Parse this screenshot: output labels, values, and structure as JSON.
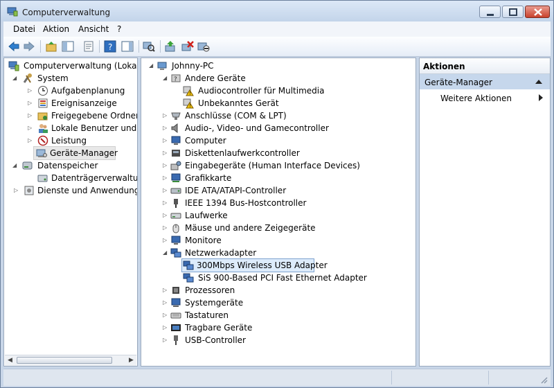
{
  "window": {
    "title": "Computerverwaltung"
  },
  "menu": [
    "Datei",
    "Aktion",
    "Ansicht",
    "?"
  ],
  "toolbar": {
    "icons": [
      "back-arrow-icon",
      "forward-arrow-icon",
      "up-folder-icon",
      "show-hide-tree-icon",
      "properties-icon",
      "help-icon",
      "show-action-pane-icon",
      "scan-hardware-icon",
      "update-driver-icon",
      "uninstall-device-icon",
      "disable-device-icon"
    ]
  },
  "left_tree": [
    {
      "label": "Computerverwaltung (Lokal)",
      "icon": "computer-management-icon"
    },
    {
      "label": "System",
      "icon": "system-tools-icon"
    },
    {
      "label": "Aufgabenplanung",
      "icon": "clock-icon"
    },
    {
      "label": "Ereignisanzeige",
      "icon": "event-viewer-icon"
    },
    {
      "label": "Freigegebene Ordner",
      "icon": "shared-folder-icon"
    },
    {
      "label": "Lokale Benutzer und Gr",
      "icon": "users-icon"
    },
    {
      "label": "Leistung",
      "icon": "performance-icon"
    },
    {
      "label": "Geräte-Manager",
      "icon": "device-manager-icon"
    },
    {
      "label": "Datenspeicher",
      "icon": "storage-icon"
    },
    {
      "label": "Datenträgerverwaltung",
      "icon": "disk-management-icon"
    },
    {
      "label": "Dienste und Anwendungen",
      "icon": "services-icon"
    }
  ],
  "device_tree": [
    {
      "label": "Johnny-PC",
      "icon": "computer-icon"
    },
    {
      "label": "Andere Geräte",
      "icon": "unknown-device-icon"
    },
    {
      "label": "Audiocontroller für Multimedia",
      "icon": "warning-device-icon"
    },
    {
      "label": "Unbekanntes Gerät",
      "icon": "warning-device-icon"
    },
    {
      "label": "Anschlüsse (COM & LPT)",
      "icon": "port-icon"
    },
    {
      "label": "Audio-, Video- und Gamecontroller",
      "icon": "speaker-icon"
    },
    {
      "label": "Computer",
      "icon": "monitor-icon"
    },
    {
      "label": "Diskettenlaufwerkcontroller",
      "icon": "controller-icon"
    },
    {
      "label": "Eingabegeräte (Human Interface Devices)",
      "icon": "hid-icon"
    },
    {
      "label": "Grafikkarte",
      "icon": "display-adapter-icon"
    },
    {
      "label": "IDE ATA/ATAPI-Controller",
      "icon": "ide-controller-icon"
    },
    {
      "label": "IEEE 1394 Bus-Hostcontroller",
      "icon": "firewire-icon"
    },
    {
      "label": "Laufwerke",
      "icon": "disk-drive-icon"
    },
    {
      "label": "Mäuse und andere Zeigegeräte",
      "icon": "mouse-icon"
    },
    {
      "label": "Monitore",
      "icon": "monitor-icon"
    },
    {
      "label": "Netzwerkadapter",
      "icon": "network-adapter-icon"
    },
    {
      "label": "300Mbps Wireless USB Adapter",
      "icon": "network-adapter-icon"
    },
    {
      "label": "SiS 900-Based PCI Fast Ethernet Adapter",
      "icon": "network-adapter-icon"
    },
    {
      "label": "Prozessoren",
      "icon": "processor-icon"
    },
    {
      "label": "Systemgeräte",
      "icon": "system-device-icon"
    },
    {
      "label": "Tastaturen",
      "icon": "keyboard-icon"
    },
    {
      "label": "Tragbare Geräte",
      "icon": "portable-device-icon"
    },
    {
      "label": "USB-Controller",
      "icon": "usb-icon"
    }
  ],
  "actions": {
    "header": "Aktionen",
    "section": "Geräte-Manager",
    "item": "Weitere Aktionen"
  },
  "colors": {
    "accent": "#3a6ea5",
    "selection": "#ddecfb",
    "section": "#c6d7ec"
  }
}
